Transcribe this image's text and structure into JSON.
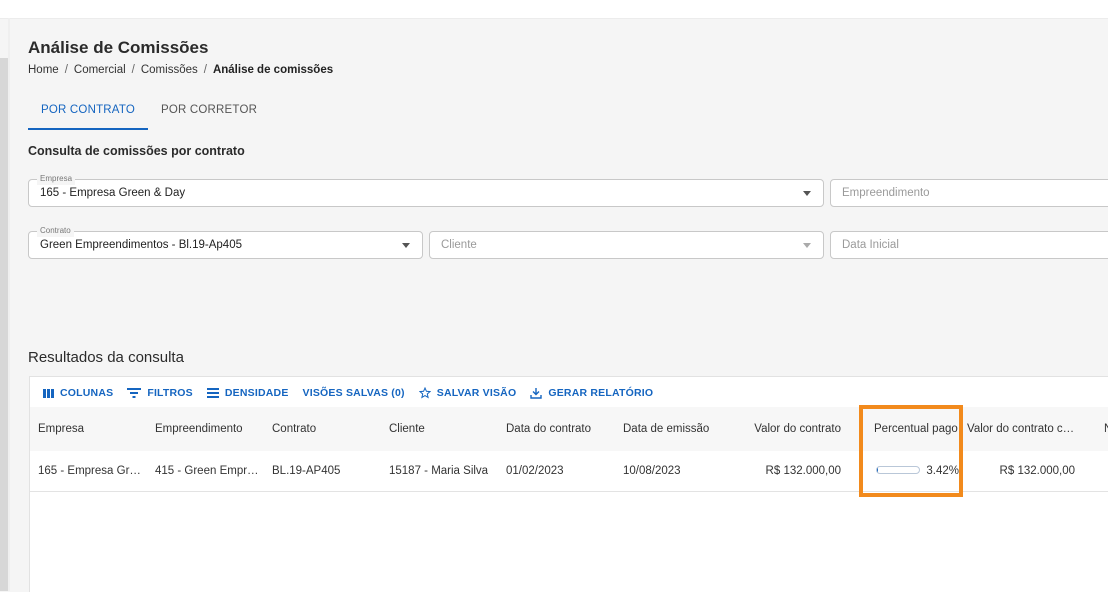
{
  "page": {
    "title": "Análise de Comissões",
    "breadcrumb": [
      "Home",
      "Comercial",
      "Comissões",
      "Análise de comissões"
    ]
  },
  "tabs": [
    {
      "label": "POR CONTRATO",
      "active": true
    },
    {
      "label": "POR CORRETOR",
      "active": false
    }
  ],
  "filters": {
    "section_title": "Consulta de comissões por contrato",
    "empresa": {
      "label": "Empresa",
      "value": "165 - Empresa Green & Day"
    },
    "empreendimento": {
      "placeholder": "Empreendimento"
    },
    "contrato": {
      "label": "Contrato",
      "value": "Green Empreendimentos - Bl.19-Ap405"
    },
    "cliente": {
      "placeholder": "Cliente"
    },
    "data_inicial": {
      "placeholder": "Data Inicial"
    }
  },
  "results": {
    "title": "Resultados da consulta",
    "toolbar": {
      "columns": "COLUNAS",
      "filters": "FILTROS",
      "density": "DENSIDADE",
      "saved_views": "VISÕES SALVAS (0)",
      "save_view": "SALVAR VISÃO",
      "report": "GERAR RELATÓRIO"
    },
    "columns": [
      "Empresa",
      "Empreendimento",
      "Contrato",
      "Cliente",
      "Data do contrato",
      "Data de emissão",
      "Valor do contrato",
      "Percentual pago",
      "Valor do contrato c…",
      "N"
    ],
    "rows": [
      {
        "empresa": "165 - Empresa Gr…",
        "empreendimento": "415 - Green Empr…",
        "contrato": "BL.19-AP405",
        "cliente": "15187 - Maria Silva",
        "data_contrato": "01/02/2023",
        "data_emissao": "10/08/2023",
        "valor_contrato": "R$ 132.000,00",
        "percentual_pago_label": "3.42%",
        "percentual_pago_value": 3.42,
        "valor_contrato_c": "R$ 132.000,00"
      }
    ]
  },
  "colors": {
    "accent": "#1565c0",
    "highlight": "#f28a1c"
  }
}
